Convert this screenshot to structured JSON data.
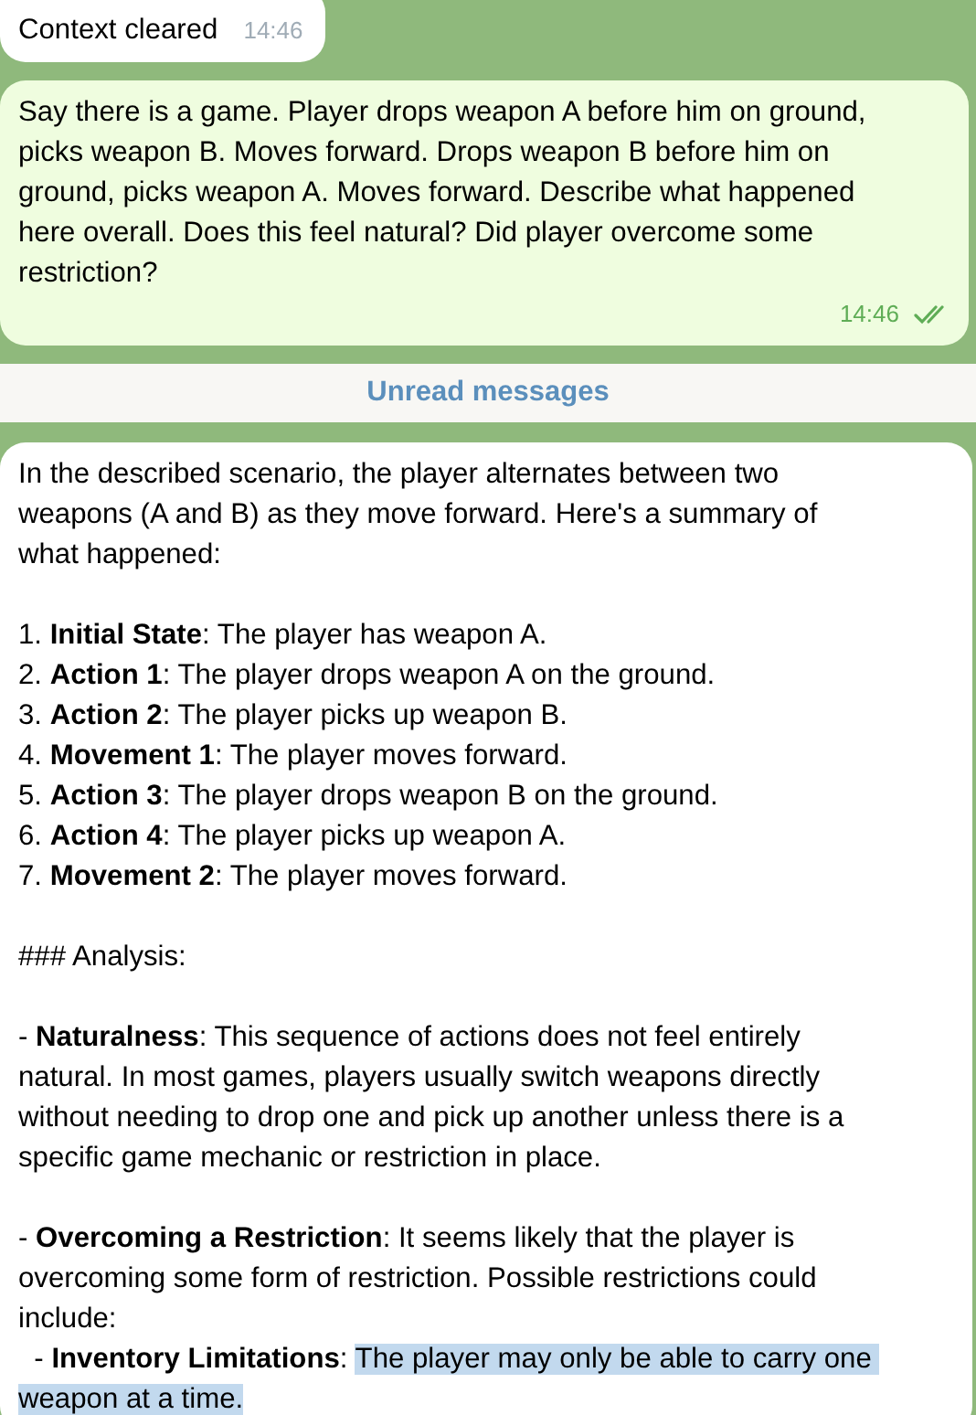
{
  "messages": [
    {
      "kind": "incoming",
      "paragraphs": [
        {
          "lines": [
            [
              {
                "text": "Context cleared",
                "selected": false
              }
            ]
          ]
        }
      ],
      "time": "14:46",
      "read": false
    },
    {
      "kind": "outgoing",
      "paragraphs": [
        {
          "lines": [
            [
              {
                "text": "Say there is a game. Player drops weapon A before him on ground,",
                "selected": false
              }
            ],
            [
              {
                "text": "picks weapon B. Moves forward. Drops weapon B before him on",
                "selected": false
              }
            ],
            [
              {
                "text": "ground, picks weapon A. Moves forward. Describe what happened",
                "selected": false
              }
            ],
            [
              {
                "text": "here overall. Does this feel natural? Did player overcome some",
                "selected": false
              }
            ],
            [
              {
                "text": "restriction?",
                "selected": false
              }
            ]
          ]
        }
      ],
      "time": "14:46",
      "read": true
    },
    {
      "kind": "divider",
      "label": "Unread messages"
    },
    {
      "kind": "incoming",
      "paragraphs": [
        {
          "lines": [
            [
              {
                "text": "In the described scenario, the player alternates between two",
                "selected": false
              }
            ],
            [
              {
                "text": "weapons (A and B) as they move forward. Here's a summary of",
                "selected": false
              }
            ],
            [
              {
                "text": "what happened:",
                "selected": false
              }
            ]
          ]
        },
        {
          "lines": [
            [
              {
                "text": "1. **Initial State**: The player has weapon A.",
                "selected": false
              }
            ],
            [
              {
                "text": "2. **Action 1**: The player drops weapon A on the ground.",
                "selected": false
              }
            ],
            [
              {
                "text": "3. **Action 2**: The player picks up weapon B.",
                "selected": false
              }
            ],
            [
              {
                "text": "4. **Movement 1**: The player moves forward.",
                "selected": false
              }
            ],
            [
              {
                "text": "5. **Action 3**: The player drops weapon B on the ground.",
                "selected": false
              }
            ],
            [
              {
                "text": "6. **Action 4**: The player picks up weapon A.",
                "selected": false
              }
            ],
            [
              {
                "text": "7. **Movement 2**: The player moves forward.",
                "selected": false
              }
            ]
          ]
        },
        {
          "lines": [
            [
              {
                "text": "### Analysis:",
                "selected": false
              }
            ]
          ]
        },
        {
          "lines": [
            [
              {
                "text": "- **Naturalness**: This sequence of actions does not feel entirely",
                "selected": false
              }
            ],
            [
              {
                "text": "natural. In most games, players usually switch weapons directly",
                "selected": false
              }
            ],
            [
              {
                "text": "without needing to drop one and pick up another unless there is a",
                "selected": false
              }
            ],
            [
              {
                "text": "specific game mechanic or restriction in place.",
                "selected": false
              }
            ]
          ]
        },
        {
          "lines": [
            [
              {
                "text": "- **Overcoming a Restriction**: It seems likely that the player is",
                "selected": false
              }
            ],
            [
              {
                "text": "overcoming some form of restriction. Possible restrictions could",
                "selected": false
              }
            ],
            [
              {
                "text": "include:",
                "selected": false
              }
            ],
            [
              {
                "text": "  - **Inventory Limitations**: ",
                "selected": false
              },
              {
                "text": "The player may only be able to carry one ",
                "selected": true
              }
            ],
            [
              {
                "text": "weapon at a time.",
                "selected": true
              }
            ]
          ]
        }
      ]
    }
  ]
}
